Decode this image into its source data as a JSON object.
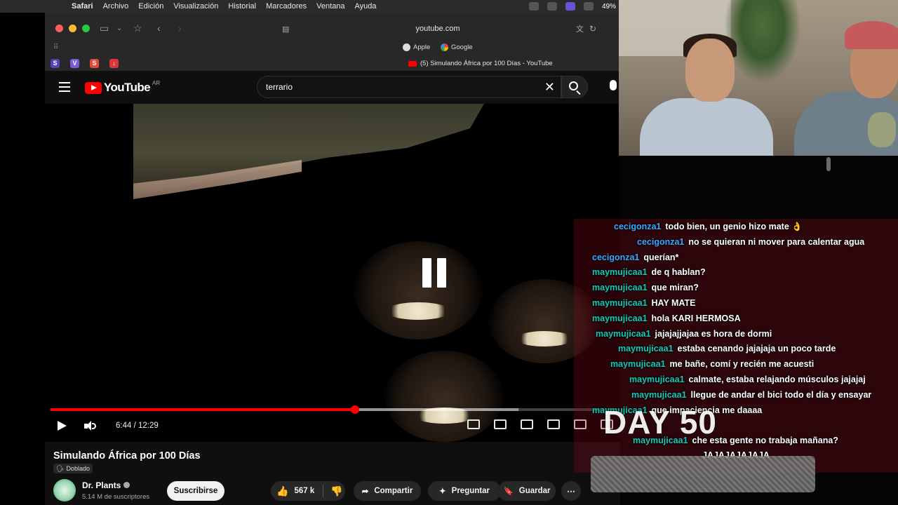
{
  "menubar": {
    "apple": "",
    "items": [
      "Safari",
      "Archivo",
      "Edición",
      "Visualización",
      "Historial",
      "Marcadores",
      "Ventana",
      "Ayuda"
    ],
    "battery": "49%"
  },
  "safari": {
    "url": "youtube.com",
    "favorites": [
      "Apple",
      "Google"
    ],
    "tab_title": "(5) Simulando África por 100 Días - YouTube",
    "extensions": [
      "S",
      "V",
      "S",
      "↓"
    ]
  },
  "youtube": {
    "logo_text": "YouTube",
    "country": "AR",
    "search_value": "terrario",
    "player": {
      "time": "6:44 / 12:29",
      "progress": 0.54,
      "buffered": 0.83,
      "state": "paused"
    },
    "video_title": "Simulando África por 100 Días",
    "dubbed_label": "Doblado",
    "channel": {
      "name": "Dr. Plants",
      "subscribers": "5.14 M de suscriptores"
    },
    "subscribe_label": "Suscribirse",
    "likes": "567 k",
    "share_label": "Compartir",
    "ask_label": "Preguntar",
    "save_label": "Guardar"
  },
  "overlay": {
    "day_text": "DAY 50",
    "chat": [
      {
        "user": "cecigonza1",
        "msg": "todo bien, un genio hizo mate 👌"
      },
      {
        "user": "cecigonza1",
        "msg": "no se quieran ni mover para calentar agua"
      },
      {
        "user": "cecigonza1",
        "msg": "querían*"
      },
      {
        "user": "maymujicaa1",
        "msg": "de q hablan?"
      },
      {
        "user": "maymujicaa1",
        "msg": "que miran?"
      },
      {
        "user": "maymujicaa1",
        "msg": "HAY MATE"
      },
      {
        "user": "maymujicaa1",
        "msg": "hola KARI HERMOSA"
      },
      {
        "user": "maymujicaa1",
        "msg": "jajajajjajaa es hora de dormi"
      },
      {
        "user": "maymujicaa1",
        "msg": "estaba cenando jajajaja un poco tarde"
      },
      {
        "user": "maymujicaa1",
        "msg": "me bañe, comí y recién me acuesti"
      },
      {
        "user": "maymujicaa1",
        "msg": "calmate, estaba relajando músculos jajajaj"
      },
      {
        "user": "maymujicaa1",
        "msg": "llegue de andar el bici todo el día y ensayar"
      },
      {
        "user": "maymujicaa1",
        "msg": "que impaciencia me daaaa"
      },
      {
        "user": "maymujicaa1",
        "msg": "che esta gente no trabaja mañana?"
      },
      {
        "user": "",
        "msg": "JAJAJAJAJAJA"
      }
    ]
  },
  "colors": {
    "yt_red": "#ff0000",
    "chat_user_blue": "#3aa8ff",
    "chat_user_teal": "#15c9b6"
  }
}
